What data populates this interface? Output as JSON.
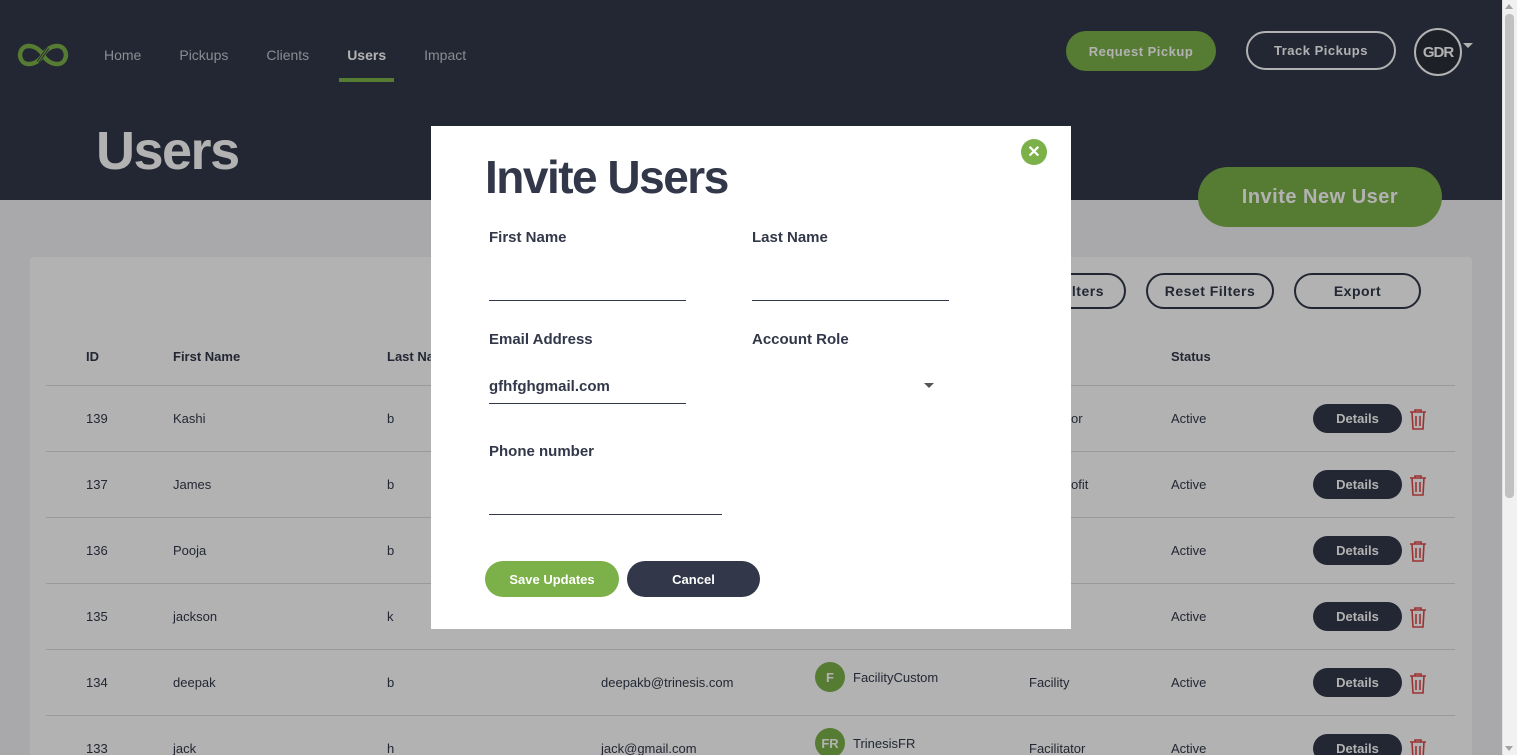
{
  "nav": {
    "logo": "infinity-fork-logo",
    "items": [
      {
        "label": "Home"
      },
      {
        "label": "Pickups"
      },
      {
        "label": "Clients"
      },
      {
        "label": "Users",
        "active": true
      },
      {
        "label": "Impact"
      }
    ],
    "request_pickup": "Request Pickup",
    "track_pickups": "Track Pickups",
    "avatar_text": "GDR"
  },
  "page": {
    "title": "Users",
    "invite_button": "Invite New User"
  },
  "toolbar": {
    "filters_partial": "lters",
    "reset_filters": "Reset Filters",
    "export": "Export"
  },
  "table": {
    "headers": {
      "id": "ID",
      "first_name": "First Name",
      "last_name_partial": "Last Na",
      "status": "Status"
    },
    "details_label": "Details",
    "rows": [
      {
        "id": "139",
        "first": "Kashi",
        "last": "b",
        "email": "",
        "badge": "",
        "client": "",
        "role": "or",
        "status": "Active"
      },
      {
        "id": "137",
        "first": "James",
        "last": "b",
        "email": "",
        "badge": "",
        "client": "",
        "role": "ofit",
        "status": "Active"
      },
      {
        "id": "136",
        "first": "Pooja",
        "last": "b",
        "email": "",
        "badge": "",
        "client": "",
        "role": "",
        "status": "Active"
      },
      {
        "id": "135",
        "first": "jackson",
        "last": "k",
        "email": "",
        "badge": "",
        "client": "",
        "role": "",
        "status": "Active"
      },
      {
        "id": "134",
        "first": "deepak",
        "last": "b",
        "email": "deepakb@trinesis.com",
        "badge": "F",
        "client": "FacilityCustom",
        "role": "Facility",
        "status": "Active"
      },
      {
        "id": "133",
        "first": "jack",
        "last": "h",
        "email": "jack@gmail.com",
        "badge": "FR",
        "client": "TrinesisFR",
        "role": "Facilitator",
        "status": "Active"
      }
    ]
  },
  "modal": {
    "title": "Invite Users",
    "close_icon": "close-icon",
    "first_name_label": "First Name",
    "first_name_value": "",
    "last_name_label": "Last Name",
    "last_name_value": "",
    "email_label": "Email Address",
    "email_value": "gfhfghgmail.com",
    "role_label": "Account Role",
    "role_value": "",
    "phone_label": "Phone number",
    "phone_value": "",
    "save_button": "Save Updates",
    "cancel_button": "Cancel"
  },
  "colors": {
    "brand_green": "#7cb048",
    "navy": "#323849",
    "delete_red": "#e0494a"
  }
}
